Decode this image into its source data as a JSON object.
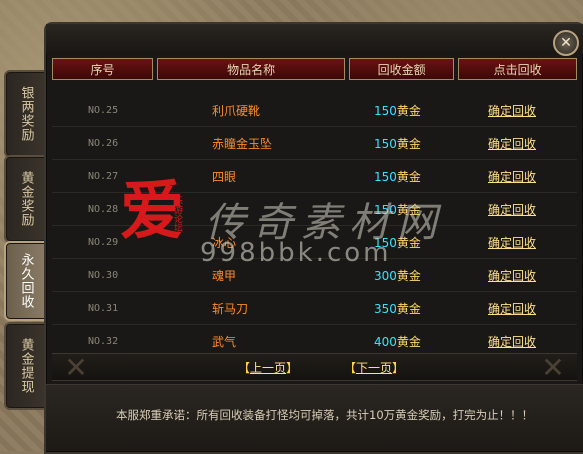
{
  "side_tabs": [
    {
      "label": "银两奖励"
    },
    {
      "label": "黄金奖励"
    },
    {
      "label": "永久回收"
    },
    {
      "label": "黄金提现"
    }
  ],
  "table": {
    "headers": [
      "序号",
      "物品名称",
      "回收金额",
      "点击回收"
    ],
    "rows": [
      {
        "no": "NO.25",
        "name": "利爪硬靴",
        "amount": "150",
        "unit": "黄金",
        "action": "确定回收"
      },
      {
        "no": "NO.26",
        "name": "赤瞳金玉坠",
        "amount": "150",
        "unit": "黄金",
        "action": "确定回收"
      },
      {
        "no": "NO.27",
        "name": "四眼",
        "amount": "150",
        "unit": "黄金",
        "action": "确定回收"
      },
      {
        "no": "NO.28",
        "name": "",
        "amount": "150",
        "unit": "黄金",
        "action": "确定回收"
      },
      {
        "no": "NO.29",
        "name": "冰心",
        "amount": "150",
        "unit": "黄金",
        "action": "确定回收"
      },
      {
        "no": "NO.30",
        "name": "魂甲",
        "amount": "300",
        "unit": "黄金",
        "action": "确定回收"
      },
      {
        "no": "NO.31",
        "name": "斩马刀",
        "amount": "350",
        "unit": "黄金",
        "action": "确定回收"
      },
      {
        "no": "NO.32",
        "name": "武气",
        "amount": "400",
        "unit": "黄金",
        "action": "确定回收"
      }
    ]
  },
  "pager": {
    "prev_open": "【",
    "prev_label": "上一页",
    "prev_close": "】",
    "next_open": "【",
    "next_label": "下一页",
    "next_close": "】"
  },
  "footer": {
    "text": "本服郑重承诺：所有回收装备打怪均可掉落，共计10万黄金奖励，打完为止！！！"
  },
  "watermark": {
    "big_char": "爱",
    "vertical_text": "乐游论坛",
    "brush_text": "传奇素材网",
    "url": "998bbk.com"
  },
  "colors": {
    "item_name": "#ff8a27",
    "amount": "#35e3ff",
    "gold_text": "#ffe08a",
    "header_bg": "#6a1212"
  },
  "icons": {
    "close": "close-icon"
  }
}
